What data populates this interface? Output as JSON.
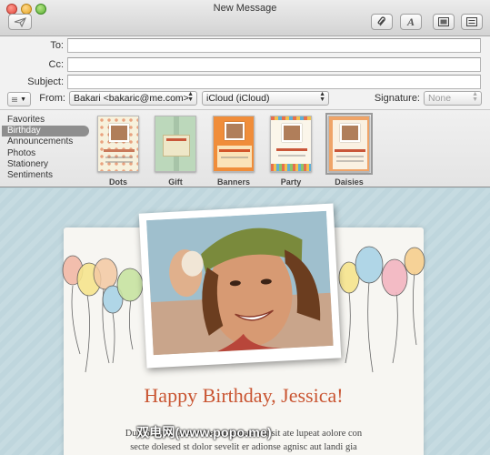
{
  "window": {
    "title": "New Message"
  },
  "toolbar": {
    "send_icon": "paper-plane-icon",
    "attach_icon": "paperclip-icon",
    "font_icon": "font-A-icon",
    "font_glyph": "A",
    "photo_icon": "photo-browser-icon",
    "list_icon": "header-fields-icon"
  },
  "headers": {
    "to_label": "To:",
    "to_value": "",
    "cc_label": "Cc:",
    "cc_value": "",
    "subject_label": "Subject:",
    "subject_value": "",
    "from_label": "From:",
    "from_value": "Bakari <bakaric@me.com>",
    "account_value": "iCloud (iCloud)",
    "signature_label": "Signature:",
    "signature_value": "None",
    "options_icon": "list-options-icon"
  },
  "stationery": {
    "categories": [
      "Favorites",
      "Birthday",
      "Announcements",
      "Photos",
      "Stationery",
      "Sentiments"
    ],
    "selected_category": "Birthday",
    "templates": [
      {
        "name": "Dots",
        "color": "#f5efd6"
      },
      {
        "name": "Gift",
        "color": "#bfd9bd"
      },
      {
        "name": "Banners",
        "color": "#f08d3a"
      },
      {
        "name": "Party",
        "color": "#fbf6ea"
      },
      {
        "name": "Daisies",
        "color": "#f0a56a"
      }
    ],
    "selected_template": "Daisies"
  },
  "message": {
    "heading": "Happy Birthday, Jessica!",
    "body_line1": "Duis nostrud tatet vel et vulputate ver sit ate lupeat aolore con",
    "body_line2": "secte dolesed st dolor sevelit er adionse agnisc aut landi gia",
    "accent_color": "#c95532"
  },
  "watermark": "双电网(www.popo.me)"
}
